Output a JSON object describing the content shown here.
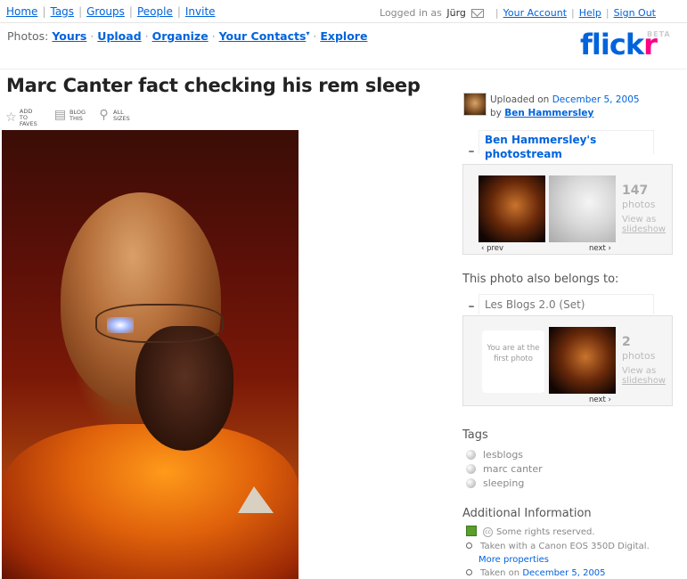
{
  "topnav": {
    "items": [
      "Home",
      "Tags",
      "Groups",
      "People",
      "Invite"
    ]
  },
  "account": {
    "logged_in_as": "Logged in as",
    "username": "Jürg",
    "your_account": "Your Account",
    "help": "Help",
    "sign_out": "Sign Out"
  },
  "subnav": {
    "prefix": "Photos:",
    "items": [
      "Yours",
      "Upload",
      "Organize",
      "Your Contacts",
      "Explore"
    ]
  },
  "logo": {
    "text_blue": "flick",
    "text_pink": "r",
    "beta": "BETA"
  },
  "photo": {
    "title": "Marc Canter fact checking his rem sleep",
    "actions": [
      {
        "line1": "ADD TO",
        "line2": "FAVES"
      },
      {
        "line1": "BLOG",
        "line2": "THIS"
      },
      {
        "line1": "ALL",
        "line2": "SIZES"
      }
    ]
  },
  "uploader": {
    "uploaded_on_label": "Uploaded on",
    "uploaded_on_date": "December 5, 2005",
    "by_label": "by",
    "name": "Ben Hammersley"
  },
  "photostream": {
    "title": "Ben Hammersley's photostream",
    "count": "147",
    "count_label": "photos",
    "view_as": "View as",
    "slideshow": "slideshow",
    "prev": "‹ prev",
    "next": "next ›"
  },
  "belongs": {
    "heading": "This photo also belongs to:",
    "set_title": "Les Blogs 2.0 (Set)",
    "first_photo_note": "You are at the first photo",
    "count": "2",
    "count_label": "photos",
    "view_as": "View as",
    "slideshow": "slideshow",
    "next": "next ›"
  },
  "tags": {
    "heading": "Tags",
    "items": [
      "lesblogs",
      "marc canter",
      "sleeping"
    ]
  },
  "additional": {
    "heading": "Additional Information",
    "rights": "Some rights reserved.",
    "camera": "Taken with a Canon EOS 350D Digital.",
    "more_properties": "More properties",
    "taken_on_label": "Taken on",
    "taken_on_date": "December 5, 2005"
  },
  "colors": {
    "link": "#0063dc",
    "pink": "#ff0084"
  }
}
